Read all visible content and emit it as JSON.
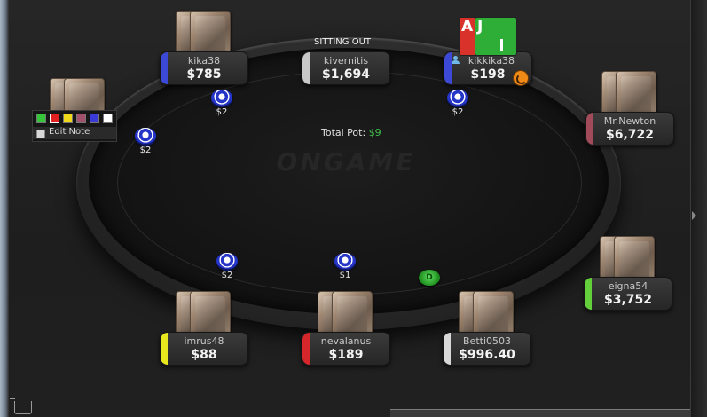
{
  "table": {
    "logo": "ONGAME",
    "sitting_out": "SITTING OUT",
    "total_pot_label": "Total Pot:",
    "total_pot_value": "$9"
  },
  "seats": [
    {
      "id": "kika38",
      "name": "kika38",
      "stack": "$785",
      "accent": "#3b49d6"
    },
    {
      "id": "kivernitis",
      "name": "kivernitis",
      "stack": "$1,694",
      "accent": "#c8c8c8"
    },
    {
      "id": "kikkika38",
      "name": "kikkika38",
      "stack": "$198",
      "accent": "#3b49d6"
    },
    {
      "id": "mrnewton",
      "name": "Mr.Newton",
      "stack": "$6,722",
      "accent": "#a04a5a"
    },
    {
      "id": "eigna54",
      "name": "eigna54",
      "stack": "$3,752",
      "accent": "#63cf3a"
    },
    {
      "id": "betti0503",
      "name": "Betti0503",
      "stack": "$996.40",
      "accent": "#d8d8d8"
    },
    {
      "id": "nevalanus",
      "name": "nevalanus",
      "stack": "$189",
      "accent": "#d4262b"
    },
    {
      "id": "imrus48",
      "name": "imrus48",
      "stack": "$88",
      "accent": "#e8e81e"
    }
  ],
  "hero_cards": [
    "A",
    "J"
  ],
  "bets": [
    "$2",
    "$2",
    "$2",
    "$2",
    "$1"
  ],
  "dealer_button": "D",
  "note_tool": {
    "label": "Edit Note",
    "colors": [
      "#35c43a",
      "#e02020",
      "#f0d81a",
      "#a0506a",
      "#3a3ad8",
      "#ffffff"
    ]
  }
}
